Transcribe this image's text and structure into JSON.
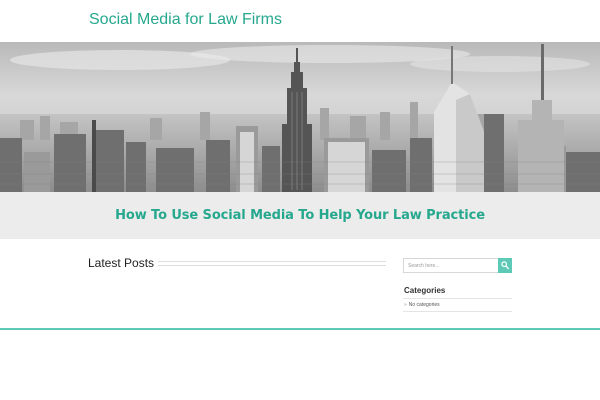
{
  "header": {
    "site_title": "Social Media for Law Firms"
  },
  "banner": {
    "alt": "Black and white city skyline"
  },
  "featured": {
    "headline": "How To Use Social Media To Help Your Law Practice"
  },
  "main": {
    "latest_posts_title": "Latest Posts"
  },
  "sidebar": {
    "search": {
      "placeholder": "Search here...",
      "icon": "search-icon"
    },
    "categories": {
      "title": "Categories",
      "items": [
        "No categories"
      ]
    }
  },
  "colors": {
    "accent": "#26a88e",
    "accent_light": "#5ccab6",
    "band": "#ececec"
  }
}
